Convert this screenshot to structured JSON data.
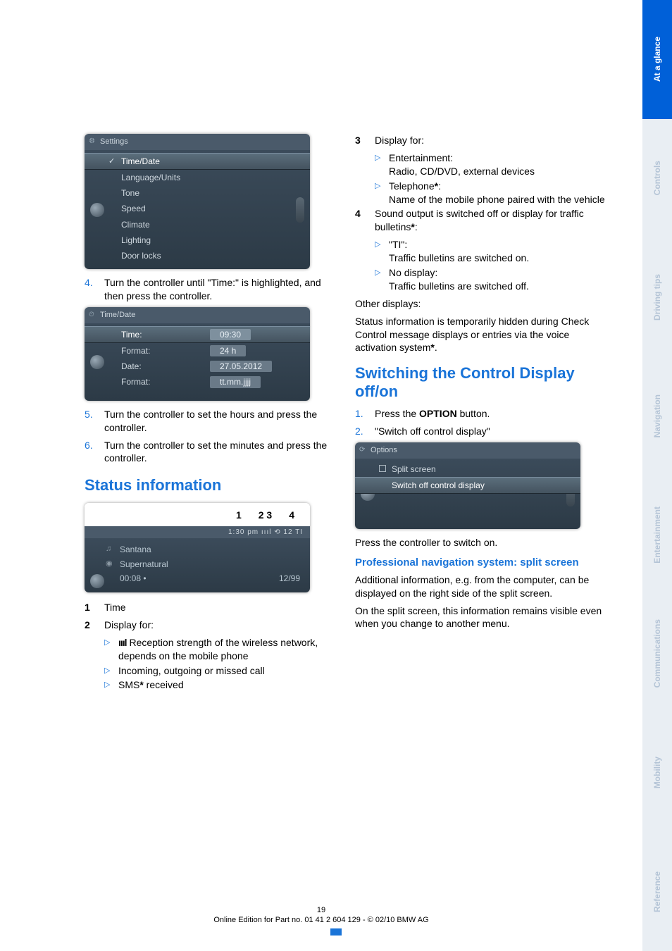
{
  "sidebar": {
    "tabs": [
      {
        "label": "At a glance",
        "active": true
      },
      {
        "label": "Controls",
        "active": false
      },
      {
        "label": "Driving tips",
        "active": false
      },
      {
        "label": "Navigation",
        "active": false
      },
      {
        "label": "Entertainment",
        "active": false
      },
      {
        "label": "Communications",
        "active": false
      },
      {
        "label": "Mobility",
        "active": false
      },
      {
        "label": "Reference",
        "active": false
      }
    ]
  },
  "left": {
    "shot1": {
      "header": "Settings",
      "rows": [
        "Time/Date",
        "Language/Units",
        "Tone",
        "Speed",
        "Climate",
        "Lighting",
        "Door locks"
      ]
    },
    "step4": {
      "n": "4.",
      "t": "Turn the controller until \"Time:\" is highlighted, and then press the controller."
    },
    "shot2": {
      "header": "Time/Date",
      "rows": [
        {
          "label": "Time:",
          "val": "09:30"
        },
        {
          "label": "Format:",
          "val": "24 h"
        },
        {
          "label": "Date:",
          "val": "27.05.2012"
        },
        {
          "label": "Format:",
          "val": "tt.mm.jjjj"
        }
      ]
    },
    "step5": {
      "n": "5.",
      "t": "Turn the controller to set the hours and press the controller."
    },
    "step6": {
      "n": "6.",
      "t": "Turn the controller to set the minutes and press the controller."
    },
    "status_heading": "Status information",
    "status_labels": [
      "1",
      "2 3",
      "4"
    ],
    "status_bar": "1:30 pm   ıııl   ⟲ 12   TI",
    "status_rows": [
      {
        "label": "Santana",
        "right": ""
      },
      {
        "label": "Supernatural",
        "right": ""
      },
      {
        "label": "00:08  •",
        "right": "12/99"
      }
    ],
    "legend": {
      "i1": {
        "n": "1",
        "t": "Time"
      },
      "i2": {
        "n": "2",
        "t": "Display for:"
      },
      "b1": "Reception strength of the wireless network, depends on the mobile phone",
      "b2": "Incoming, outgoing or missed call",
      "b3": "SMS",
      "b3_suffix": " received"
    }
  },
  "right": {
    "i3": {
      "n": "3",
      "t": "Display for:"
    },
    "b_ent_h": "Entertainment:",
    "b_ent_t": "Radio, CD/DVD, external devices",
    "b_tel_h": "Telephone",
    "b_tel_t": "Name of the mobile phone paired with the vehicle",
    "i4": {
      "n": "4",
      "t": "Sound output is switched off or display for traffic bulletins"
    },
    "b_ti_h": "\"TI\":",
    "b_ti_t": "Traffic bulletins are switched on.",
    "b_nd_h": "No display:",
    "b_nd_t": "Traffic bulletins are switched off.",
    "other_h": "Other displays:",
    "other_t": "Status information is temporarily hidden during Check Control message displays or entries via the voice activation system",
    "switch_heading": "Switching the Control Display off/on",
    "s1": {
      "n": "1.",
      "t_pre": "Press the ",
      "t_bold": "OPTION",
      "t_post": " button."
    },
    "s2": {
      "n": "2.",
      "t": "\"Switch off control display\""
    },
    "shot3": {
      "header": "Options",
      "rows": [
        "Split screen",
        "Switch off control display"
      ]
    },
    "press_on": "Press the controller to switch on.",
    "prof_h": "Professional navigation system: split screen",
    "prof_p1": "Additional information, e.g. from the computer, can be displayed on the right side of the split screen.",
    "prof_p2": "On the split screen, this information remains visible even when you change to another menu."
  },
  "footer": {
    "page": "19",
    "line": "Online Edition for Part no. 01 41 2 604 129 - © 02/10 BMW AG"
  }
}
